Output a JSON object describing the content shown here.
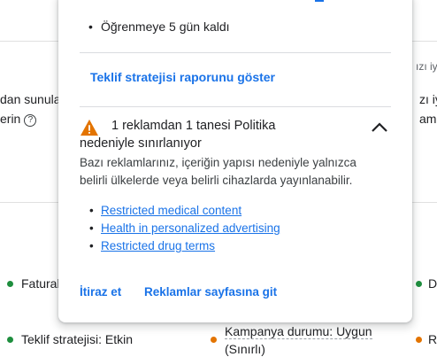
{
  "background": {
    "row1_left_line1": "dan sunula",
    "row1_left_line2": "erin",
    "row1_right_top": "ızı iy",
    "row1_right_line1": "zı iy",
    "row1_right_line2": "ama",
    "row2_left": "Fatural",
    "row2_right": "De",
    "row3_left": "Teklif stratejisi: Etkin",
    "row3_mid_line1": "Kampanya durumu: Uygun",
    "row3_mid_line2": "(Sınırlı)",
    "row3_right": "Re",
    "colors": {
      "green": "#1e8e3e",
      "orange": "#e37400"
    }
  },
  "popup": {
    "bullet_text": "Öğrenmeye 5 gün kaldı",
    "bid_report_link": "Teklif stratejisi raporunu göster",
    "warning": {
      "icon": "warning-triangle-icon",
      "title_line1": "1 reklamdan 1 tanesi Politika",
      "title_line2": "nedeniyle sınırlanıyor",
      "description": "Bazı reklamlarınız, içeriğin yapısı nedeniyle yalnızca belirli ülkelerde veya belirli cihazlarda yayınlanabilir.",
      "policy_links": [
        "Restricted medical content",
        "Health in personalized advertising",
        "Restricted drug terms"
      ],
      "colors": {
        "warning": "#e37400"
      }
    },
    "actions": {
      "appeal": "İtiraz et",
      "go_to_ads": "Reklamlar sayfasına git"
    },
    "colors": {
      "link": "#1a73e8"
    }
  }
}
